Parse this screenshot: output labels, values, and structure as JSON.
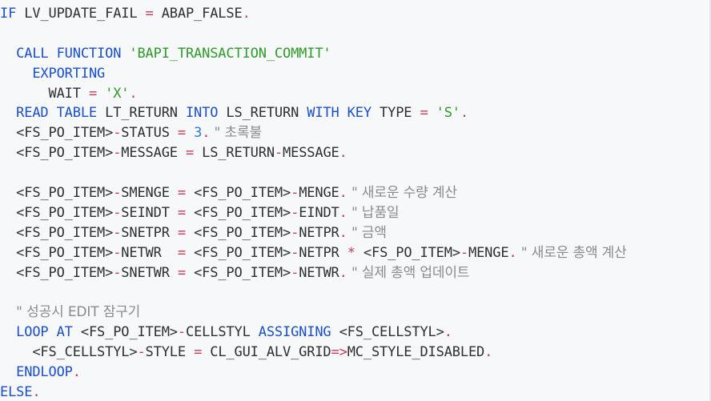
{
  "lines": [
    {
      "tokens": [
        {
          "t": "IF",
          "c": "kw"
        },
        {
          "t": " LV_UPDATE_FAIL ",
          "c": "plain"
        },
        {
          "t": "=",
          "c": "op"
        },
        {
          "t": " ABAP_FALSE",
          "c": "plain"
        },
        {
          "t": ".",
          "c": "op"
        }
      ]
    },
    {
      "tokens": []
    },
    {
      "tokens": [
        {
          "t": "  ",
          "c": "plain"
        },
        {
          "t": "CALL FUNCTION",
          "c": "kw"
        },
        {
          "t": " ",
          "c": "plain"
        },
        {
          "t": "'BAPI_TRANSACTION_COMMIT'",
          "c": "str"
        }
      ]
    },
    {
      "tokens": [
        {
          "t": "    ",
          "c": "plain"
        },
        {
          "t": "EXPORTING",
          "c": "kw"
        }
      ]
    },
    {
      "tokens": [
        {
          "t": "      WAIT ",
          "c": "plain"
        },
        {
          "t": "=",
          "c": "op"
        },
        {
          "t": " ",
          "c": "plain"
        },
        {
          "t": "'X'",
          "c": "str"
        },
        {
          "t": ".",
          "c": "op"
        }
      ]
    },
    {
      "tokens": [
        {
          "t": "  ",
          "c": "plain"
        },
        {
          "t": "READ TABLE",
          "c": "kw"
        },
        {
          "t": " LT_RETURN ",
          "c": "plain"
        },
        {
          "t": "INTO",
          "c": "kw"
        },
        {
          "t": " LS_RETURN ",
          "c": "plain"
        },
        {
          "t": "WITH KEY",
          "c": "kw"
        },
        {
          "t": " TYPE ",
          "c": "plain"
        },
        {
          "t": "=",
          "c": "op"
        },
        {
          "t": " ",
          "c": "plain"
        },
        {
          "t": "'S'",
          "c": "str"
        },
        {
          "t": ".",
          "c": "op"
        }
      ]
    },
    {
      "tokens": [
        {
          "t": "  <FS_PO_ITEM>",
          "c": "plain"
        },
        {
          "t": "-",
          "c": "op"
        },
        {
          "t": "STATUS ",
          "c": "plain"
        },
        {
          "t": "=",
          "c": "op"
        },
        {
          "t": " ",
          "c": "plain"
        },
        {
          "t": "3",
          "c": "num"
        },
        {
          "t": ".",
          "c": "op"
        },
        {
          "t": " \" 초록불",
          "c": "cmt"
        }
      ]
    },
    {
      "tokens": [
        {
          "t": "  <FS_PO_ITEM>",
          "c": "plain"
        },
        {
          "t": "-",
          "c": "op"
        },
        {
          "t": "MESSAGE ",
          "c": "plain"
        },
        {
          "t": "=",
          "c": "op"
        },
        {
          "t": " LS_RETURN",
          "c": "plain"
        },
        {
          "t": "-",
          "c": "op"
        },
        {
          "t": "MESSAGE",
          "c": "plain"
        },
        {
          "t": ".",
          "c": "op"
        }
      ]
    },
    {
      "tokens": []
    },
    {
      "tokens": [
        {
          "t": "  <FS_PO_ITEM>",
          "c": "plain"
        },
        {
          "t": "-",
          "c": "op"
        },
        {
          "t": "SMENGE ",
          "c": "plain"
        },
        {
          "t": "=",
          "c": "op"
        },
        {
          "t": " <FS_PO_ITEM>",
          "c": "plain"
        },
        {
          "t": "-",
          "c": "op"
        },
        {
          "t": "MENGE",
          "c": "plain"
        },
        {
          "t": ".",
          "c": "op"
        },
        {
          "t": " \" 새로운 수량 계산",
          "c": "cmt"
        }
      ]
    },
    {
      "tokens": [
        {
          "t": "  <FS_PO_ITEM>",
          "c": "plain"
        },
        {
          "t": "-",
          "c": "op"
        },
        {
          "t": "SEINDT ",
          "c": "plain"
        },
        {
          "t": "=",
          "c": "op"
        },
        {
          "t": " <FS_PO_ITEM>",
          "c": "plain"
        },
        {
          "t": "-",
          "c": "op"
        },
        {
          "t": "EINDT",
          "c": "plain"
        },
        {
          "t": ".",
          "c": "op"
        },
        {
          "t": " \" 납품일",
          "c": "cmt"
        }
      ]
    },
    {
      "tokens": [
        {
          "t": "  <FS_PO_ITEM>",
          "c": "plain"
        },
        {
          "t": "-",
          "c": "op"
        },
        {
          "t": "SNETPR ",
          "c": "plain"
        },
        {
          "t": "=",
          "c": "op"
        },
        {
          "t": " <FS_PO_ITEM>",
          "c": "plain"
        },
        {
          "t": "-",
          "c": "op"
        },
        {
          "t": "NETPR",
          "c": "plain"
        },
        {
          "t": ".",
          "c": "op"
        },
        {
          "t": " \" 금액",
          "c": "cmt"
        }
      ]
    },
    {
      "tokens": [
        {
          "t": "  <FS_PO_ITEM>",
          "c": "plain"
        },
        {
          "t": "-",
          "c": "op"
        },
        {
          "t": "NETWR  ",
          "c": "plain"
        },
        {
          "t": "=",
          "c": "op"
        },
        {
          "t": " <FS_PO_ITEM>",
          "c": "plain"
        },
        {
          "t": "-",
          "c": "op"
        },
        {
          "t": "NETPR ",
          "c": "plain"
        },
        {
          "t": "*",
          "c": "op"
        },
        {
          "t": " <FS_PO_ITEM>",
          "c": "plain"
        },
        {
          "t": "-",
          "c": "op"
        },
        {
          "t": "MENGE",
          "c": "plain"
        },
        {
          "t": ".",
          "c": "op"
        },
        {
          "t": " \" 새로운 총액 계산",
          "c": "cmt"
        }
      ]
    },
    {
      "tokens": [
        {
          "t": "  <FS_PO_ITEM>",
          "c": "plain"
        },
        {
          "t": "-",
          "c": "op"
        },
        {
          "t": "SNETWR ",
          "c": "plain"
        },
        {
          "t": "=",
          "c": "op"
        },
        {
          "t": " <FS_PO_ITEM>",
          "c": "plain"
        },
        {
          "t": "-",
          "c": "op"
        },
        {
          "t": "NETWR",
          "c": "plain"
        },
        {
          "t": ".",
          "c": "op"
        },
        {
          "t": " \" 실제 총액 업데이트",
          "c": "cmt"
        }
      ]
    },
    {
      "tokens": []
    },
    {
      "tokens": [
        {
          "t": "  ",
          "c": "plain"
        },
        {
          "t": "\" 성공시 EDIT 잠구기",
          "c": "cmt"
        }
      ]
    },
    {
      "tokens": [
        {
          "t": "  ",
          "c": "plain"
        },
        {
          "t": "LOOP AT",
          "c": "kw"
        },
        {
          "t": " <FS_PO_ITEM>",
          "c": "plain"
        },
        {
          "t": "-",
          "c": "op"
        },
        {
          "t": "CELLSTYL ",
          "c": "plain"
        },
        {
          "t": "ASSIGNING",
          "c": "kw"
        },
        {
          "t": " <FS_CELLSTYL>",
          "c": "plain"
        },
        {
          "t": ".",
          "c": "op"
        }
      ]
    },
    {
      "tokens": [
        {
          "t": "    <FS_CELLSTYL>",
          "c": "plain"
        },
        {
          "t": "-",
          "c": "op"
        },
        {
          "t": "STYLE ",
          "c": "plain"
        },
        {
          "t": "=",
          "c": "op"
        },
        {
          "t": " CL_GUI_ALV_GRID",
          "c": "plain"
        },
        {
          "t": "=>",
          "c": "op"
        },
        {
          "t": "MC_STYLE_DISABLED",
          "c": "plain"
        },
        {
          "t": ".",
          "c": "op"
        }
      ]
    },
    {
      "tokens": [
        {
          "t": "  ",
          "c": "plain"
        },
        {
          "t": "ENDLOOP",
          "c": "kw"
        },
        {
          "t": ".",
          "c": "op"
        }
      ]
    },
    {
      "tokens": [
        {
          "t": "ELSE",
          "c": "kw"
        },
        {
          "t": ".",
          "c": "op"
        }
      ]
    }
  ]
}
